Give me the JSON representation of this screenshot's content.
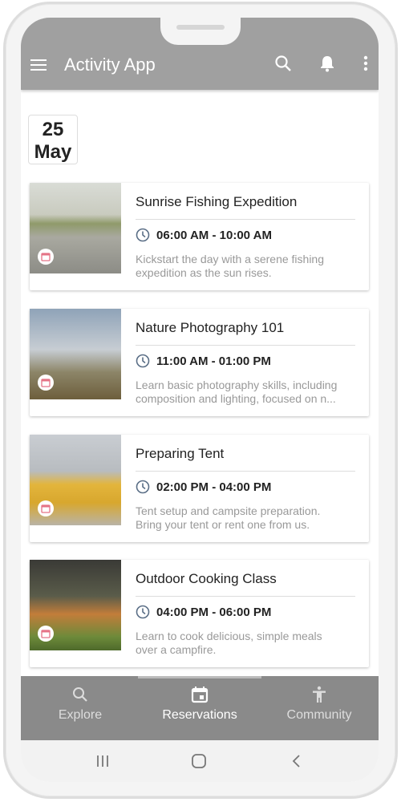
{
  "header": {
    "title": "Activity App",
    "icons": [
      "menu-icon",
      "search-icon",
      "bell-icon",
      "more-vert-icon"
    ]
  },
  "date": {
    "day": "25",
    "month": "May"
  },
  "activities": [
    {
      "title": "Sunrise Fishing Expedition",
      "time": "06:00 AM - 10:00 AM",
      "desc1": "Kickstart the day with a serene fishing",
      "desc2": "expedition as the sun rises."
    },
    {
      "title": "Nature Photography 101",
      "time": "11:00 AM - 01:00 PM",
      "desc1": "Learn basic photography skills, including",
      "desc2": "composition and lighting, focused on n..."
    },
    {
      "title": "Preparing Tent",
      "time": "02:00 PM - 04:00 PM",
      "desc1": "Tent setup and campsite preparation.",
      "desc2": "Bring your tent or rent one from us."
    },
    {
      "title": "Outdoor Cooking Class",
      "time": "04:00 PM - 06:00 PM",
      "desc1": "Learn to cook delicious, simple meals",
      "desc2": "over a campfire."
    }
  ],
  "bottom_nav": {
    "tabs": [
      {
        "label": "Explore",
        "icon": "search-icon"
      },
      {
        "label": "Reservations",
        "icon": "calendar-icon",
        "active": true
      },
      {
        "label": "Community",
        "icon": "accessibility-icon"
      }
    ]
  },
  "colors": {
    "header": "#a0a0a0",
    "bottom_nav": "#8a8a8a",
    "badge_icon": "#e57386",
    "clock": "#5a6e86"
  }
}
